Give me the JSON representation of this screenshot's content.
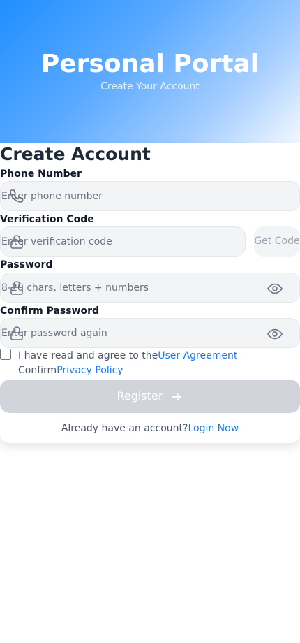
{
  "header": {
    "title": "Personal Portal",
    "subtitle": "Create Your Account"
  },
  "form": {
    "title": "Create Account",
    "phone": {
      "label": "Phone Number",
      "placeholder": "Enter phone number",
      "value": ""
    },
    "code": {
      "label": "Verification Code",
      "placeholder": "Enter verification code",
      "value": "",
      "button": "Get Code"
    },
    "password": {
      "label": "Password",
      "placeholder": "8-20 chars, letters + numbers",
      "value": ""
    },
    "confirm": {
      "label": "Confirm Password",
      "placeholder": "Enter password again",
      "value": ""
    },
    "agreement": {
      "checked": false,
      "text_prefix": "I have read and agree to the",
      "user_agreement": "User Agreement",
      "confirm_prefix": "Confirm",
      "privacy_policy": "Privacy Policy"
    },
    "register_label": "Register",
    "login_prompt": "Already have an account?",
    "login_link": "Login Now"
  },
  "icons": {
    "phone": "phone-icon",
    "lock": "lock-icon",
    "eye": "eye-icon",
    "arrow": "arrow-right-icon"
  },
  "colors": {
    "accent": "#1677ff",
    "header_gradient_start": "#1f8fff",
    "header_gradient_end": "#f3f8ff",
    "register_disabled": "#d1d5db"
  }
}
